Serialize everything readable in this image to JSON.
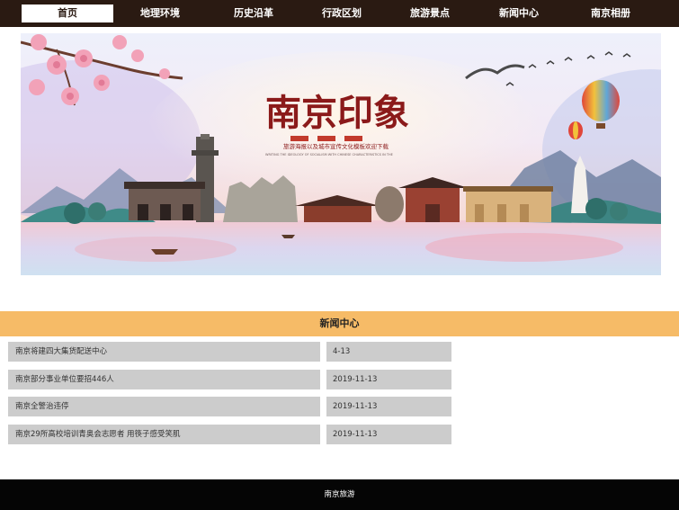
{
  "nav": {
    "items": [
      {
        "label": "首页",
        "active": true
      },
      {
        "label": "地理环境",
        "active": false
      },
      {
        "label": "历史沿革",
        "active": false
      },
      {
        "label": "行政区划",
        "active": false
      },
      {
        "label": "旅游景点",
        "active": false
      },
      {
        "label": "新闻中心",
        "active": false
      },
      {
        "label": "南京相册",
        "active": false
      }
    ]
  },
  "banner": {
    "title": "南京印象",
    "subtitle": "旅游海报以及城市宣传文化模板欢迎下载",
    "subtitle_en": "WRITING THE IDEOLOGY OF SOCIALISM WITH CHINESE CHARACTERISTICS IN THE",
    "icon": "banner-image"
  },
  "news": {
    "header": "新闻中心",
    "rows": [
      {
        "title": "南京将建四大集货配送中心",
        "date": "4-13"
      },
      {
        "title": "南京部分事业单位要招446人",
        "date": "2019-11-13"
      },
      {
        "title": "南京全警治违停",
        "date": "2019-11-13"
      },
      {
        "title": "南京29所高校培训青奥会志愿者 用筷子感受笑肌",
        "date": "2019-11-13"
      }
    ]
  },
  "footer": {
    "text": "南京旅游"
  },
  "colors": {
    "nav_bg": "#2a1a12",
    "news_header_bg": "#f6bb67",
    "row_bg": "#cccccc",
    "footer_bg": "#050505"
  }
}
